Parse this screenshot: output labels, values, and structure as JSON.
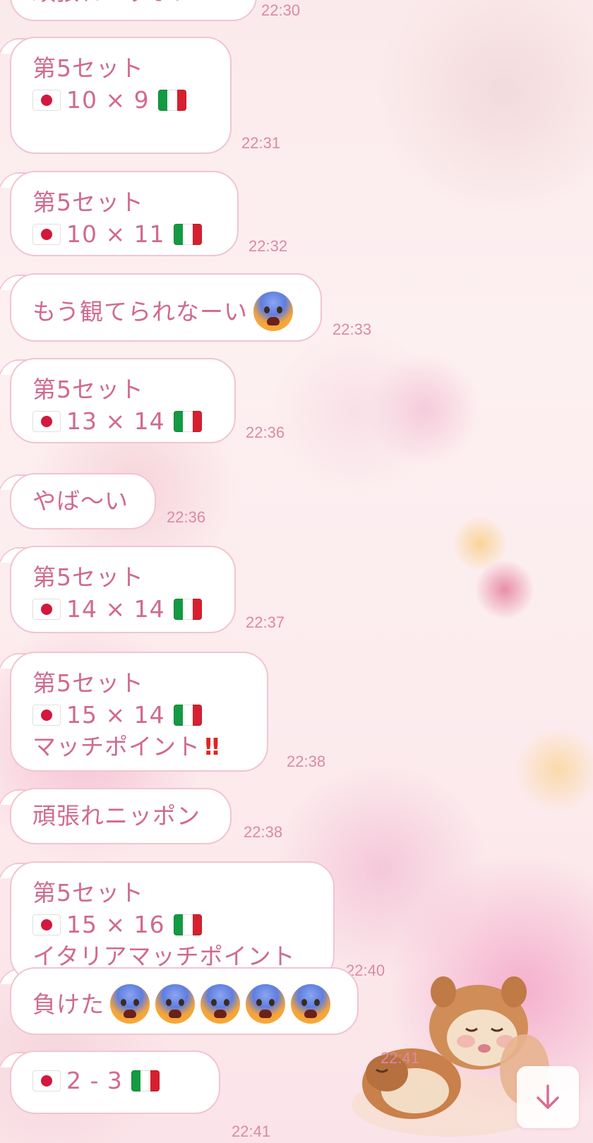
{
  "colors": {
    "bubble_text": "#d06a8e",
    "bubble_border": "#f2c4d2",
    "timestamp": "#d98aa6",
    "background": "#fbeaec"
  },
  "top_partial_message": {
    "text": "頑張れニッポン",
    "time": "22:30"
  },
  "messages": [
    {
      "lines": [
        "第5セット",
        "10 × 9"
      ],
      "flags": [
        "jp",
        "it"
      ],
      "time": "22:31"
    },
    {
      "lines": [
        "第5セット",
        "10 × 11"
      ],
      "flags": [
        "jp",
        "it"
      ],
      "time": "22:32"
    },
    {
      "lines": [
        "もう観てられなーい"
      ],
      "emoji": [
        "fearful-face"
      ],
      "time": "22:33"
    },
    {
      "lines": [
        "第5セット",
        "13 × 14"
      ],
      "flags": [
        "jp",
        "it"
      ],
      "time": "22:36"
    },
    {
      "lines": [
        "やば〜い"
      ],
      "time": "22:36"
    },
    {
      "lines": [
        "第5セット",
        "14 × 14"
      ],
      "flags": [
        "jp",
        "it"
      ],
      "time": "22:37"
    },
    {
      "lines": [
        "第5セット",
        "15 × 14",
        "マッチポイント"
      ],
      "flags": [
        "jp",
        "it"
      ],
      "emphasis": "‼",
      "time": "22:38"
    },
    {
      "lines": [
        "頑張れニッポン"
      ],
      "time": "22:38"
    },
    {
      "lines": [
        "第5セット",
        "15 × 16",
        "イタリアマッチポイント"
      ],
      "flags": [
        "jp",
        "it"
      ],
      "time": "22:40"
    },
    {
      "lines": [
        "負けた"
      ],
      "emoji": [
        "fearful-face",
        "fearful-face",
        "fearful-face",
        "fearful-face",
        "fearful-face"
      ],
      "time": "22:41"
    },
    {
      "lines": [
        "2 - 3"
      ],
      "flags": [
        "jp",
        "it"
      ],
      "time": "22:41"
    }
  ],
  "decoration": {
    "sticker": "chip-and-dale-sleeping"
  },
  "controls": {
    "scroll_down_icon": "arrow-down-icon"
  }
}
